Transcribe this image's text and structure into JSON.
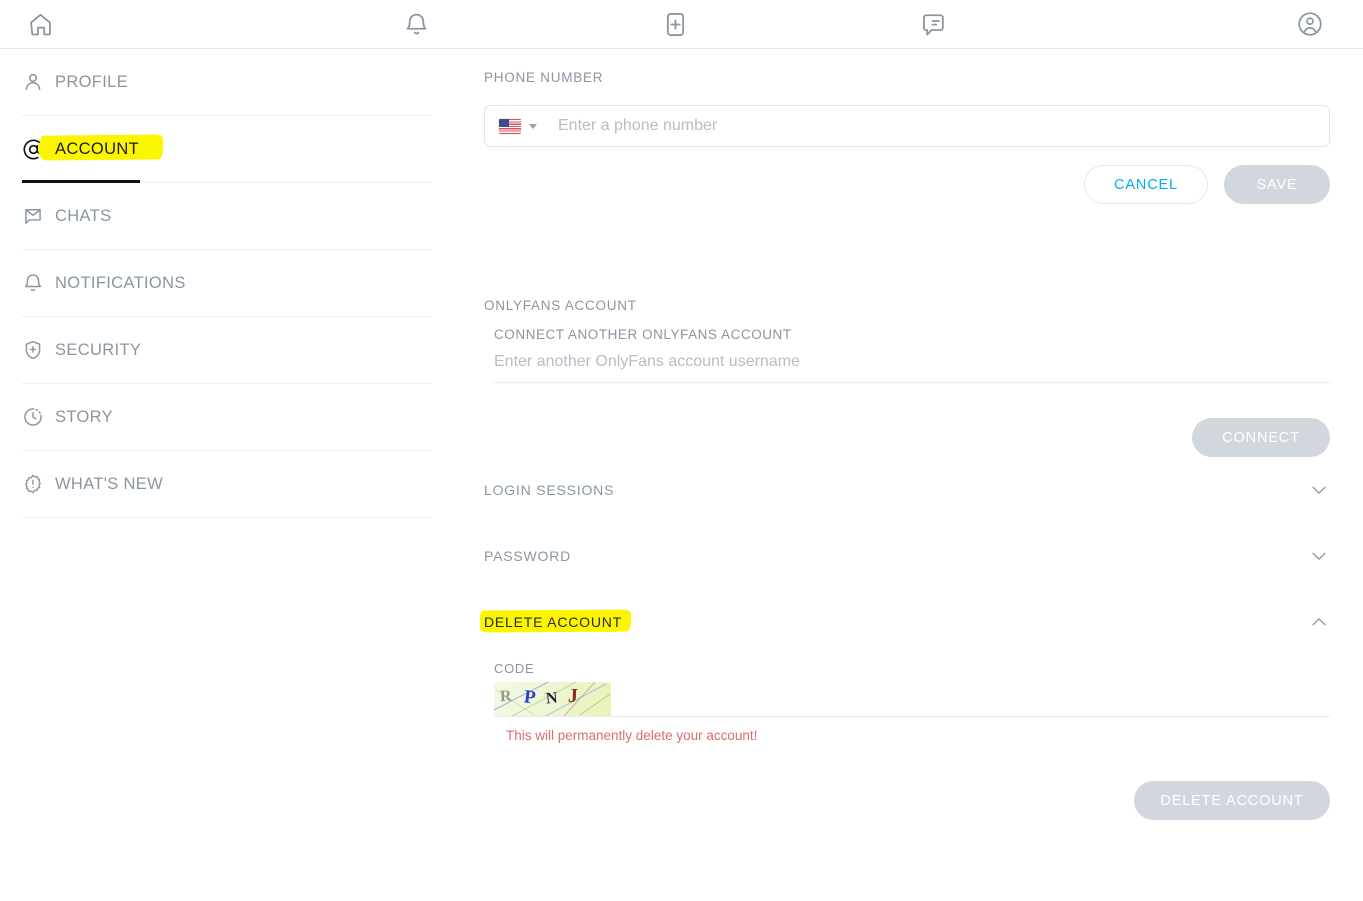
{
  "topbar": {
    "items": [
      {
        "name": "home-icon",
        "label": "Home"
      },
      {
        "name": "bell-icon",
        "label": "Notifications"
      },
      {
        "name": "add-post-icon",
        "label": "New post"
      },
      {
        "name": "messages-icon",
        "label": "Messages"
      },
      {
        "name": "avatar-icon",
        "label": "Profile"
      }
    ]
  },
  "sidebar": {
    "items": [
      {
        "label": "PROFILE",
        "icon": "person-icon",
        "active": false
      },
      {
        "label": "ACCOUNT",
        "icon": "at-icon",
        "active": true
      },
      {
        "label": "CHATS",
        "icon": "envelope-icon",
        "active": false
      },
      {
        "label": "NOTIFICATIONS",
        "icon": "bell-icon",
        "active": false
      },
      {
        "label": "SECURITY",
        "icon": "shield-icon",
        "active": false
      },
      {
        "label": "STORY",
        "icon": "clock-icon",
        "active": false
      },
      {
        "label": "WHAT'S NEW",
        "icon": "badge-alert-icon",
        "active": false
      }
    ]
  },
  "phone_section": {
    "label": "PHONE NUMBER",
    "country_flag": "us-flag-icon",
    "placeholder": "Enter a phone number",
    "value": "",
    "cancel_label": "CANCEL",
    "save_label": "SAVE"
  },
  "onlyfans_section": {
    "label": "ONLYFANS ACCOUNT",
    "sub_label": "CONNECT ANOTHER ONLYFANS ACCOUNT",
    "placeholder": "Enter another OnlyFans account username",
    "value": "",
    "connect_label": "CONNECT"
  },
  "accordions": [
    {
      "title": "LOGIN SESSIONS",
      "expanded": false,
      "chevron": "chevron-down-icon"
    },
    {
      "title": "PASSWORD",
      "expanded": false,
      "chevron": "chevron-down-icon"
    },
    {
      "title": "DELETE ACCOUNT",
      "expanded": true,
      "chevron": "chevron-up-icon"
    }
  ],
  "delete_section": {
    "code_label": "CODE",
    "captcha_text": "RPNJ",
    "captcha_chars": [
      {
        "ch": "R",
        "color": "#8f9a86"
      },
      {
        "ch": "P",
        "color": "#2b3fd4"
      },
      {
        "ch": "N",
        "color": "#1d2340"
      },
      {
        "ch": "J",
        "color": "#8d2b20"
      }
    ],
    "code_value": "",
    "warning": "This will permanently delete your account!",
    "delete_label": "DELETE ACCOUNT"
  },
  "colors": {
    "accent_blue": "#00aff0",
    "muted_text": "#8a96a1",
    "disabled_btn": "#d2d7dd",
    "warning_red": "#dc6b72",
    "highlight_yellow": "#fcf500",
    "divider": "#eceef0"
  }
}
